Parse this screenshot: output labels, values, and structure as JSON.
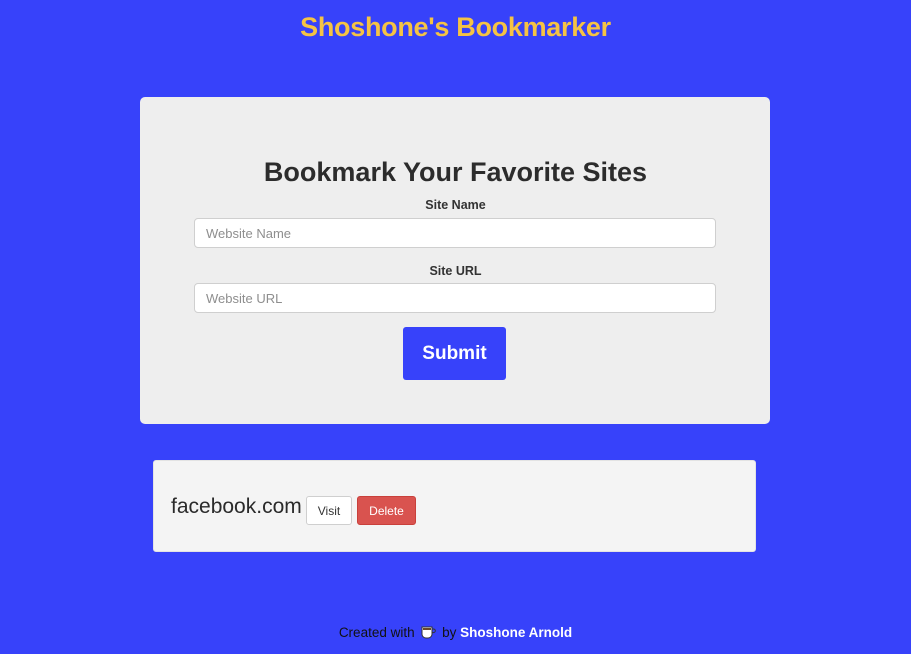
{
  "header": {
    "title": "Shoshone's Bookmarker"
  },
  "form": {
    "heading": "Bookmark Your Favorite Sites",
    "site_name_label": "Site Name",
    "site_name_placeholder": "Website Name",
    "site_name_value": "",
    "site_url_label": "Site URL",
    "site_url_placeholder": "Website URL",
    "site_url_value": "",
    "submit_label": "Submit"
  },
  "bookmarks": [
    {
      "name": "facebook.com",
      "visit_label": "Visit",
      "delete_label": "Delete"
    }
  ],
  "footer": {
    "prefix": "Created with",
    "icon": "coffee-cup-icon",
    "by": "by",
    "author": "Shoshone Arnold"
  },
  "colors": {
    "background": "#3742fa",
    "title": "#f5c344",
    "delete": "#d9534f"
  }
}
